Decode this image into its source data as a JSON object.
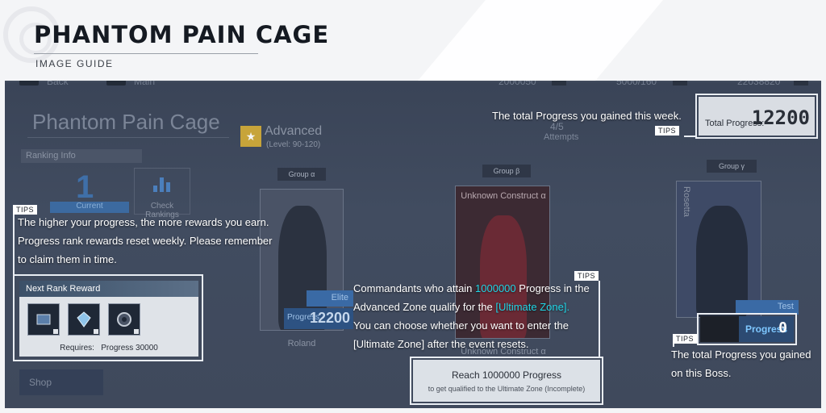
{
  "header": {
    "title": "PHANTOM PAIN CAGE",
    "subtitle": "IMAGE GUIDE"
  },
  "game": {
    "topbar": {
      "back": "Back",
      "main": "Main",
      "currency_1": "2000050",
      "stamina": "5000/160",
      "currency_2": "22038820"
    },
    "title": "Phantom Pain Cage",
    "ranking_info": "Ranking Info",
    "rank_number": "1",
    "current": "Current",
    "check_rankings": "Check Rankings",
    "zone": {
      "star": "★",
      "name": "Advanced",
      "level": "(Level: 90-120)",
      "attempts_value": "4/5",
      "attempts_label": "Attempts"
    },
    "groups": [
      {
        "tag": "Group α",
        "name": "Roland"
      },
      {
        "tag": "Group β",
        "name": "Unknown Construct α",
        "card_title": "Unknown Construct α"
      },
      {
        "tag": "Group γ",
        "card_title": "Rosetta"
      }
    ],
    "elite": "Elite",
    "card_progress_label": "Progress",
    "card_progress_value": "12200",
    "test": "Test",
    "shop": "Shop"
  },
  "tips_label": "TIPS",
  "tip_total_week": {
    "text": "The total Progress you gained this week.",
    "box_label": "Total Progress:",
    "box_value": "12200"
  },
  "tip_rank": {
    "line1": "The higher your progress, the more rewards you earn.",
    "line2": "Progress rank rewards reset weekly. Please remember",
    "line3": "to claim them in time.",
    "reward_title": "Next Rank Reward",
    "requires": "Requires:",
    "requires_value": "Progress 30000"
  },
  "tip_ultimate": {
    "l1_a": "Commandants who attain ",
    "l1_accent": "1000000",
    "l1_b": " Progress in the",
    "l2_a": "Advanced Zone qualify for the ",
    "l2_accent": "[Ultimate Zone].",
    "l3": "You can choose whether you want to enter the",
    "l4": "[Ultimate Zone] after the event resets.",
    "reach_main": "Reach 1000000 Progress",
    "reach_sub": "to get qualified to the Ultimate Zone (Incomplete)"
  },
  "tip_boss": {
    "line1": "The total Progress you gained",
    "line2": "on this Boss.",
    "box_label": "Progress",
    "box_value": "0"
  },
  "colors": {
    "accent": "#1fd6e6",
    "screen_bg": "#3f495c",
    "highlight": "#e9edf3"
  }
}
